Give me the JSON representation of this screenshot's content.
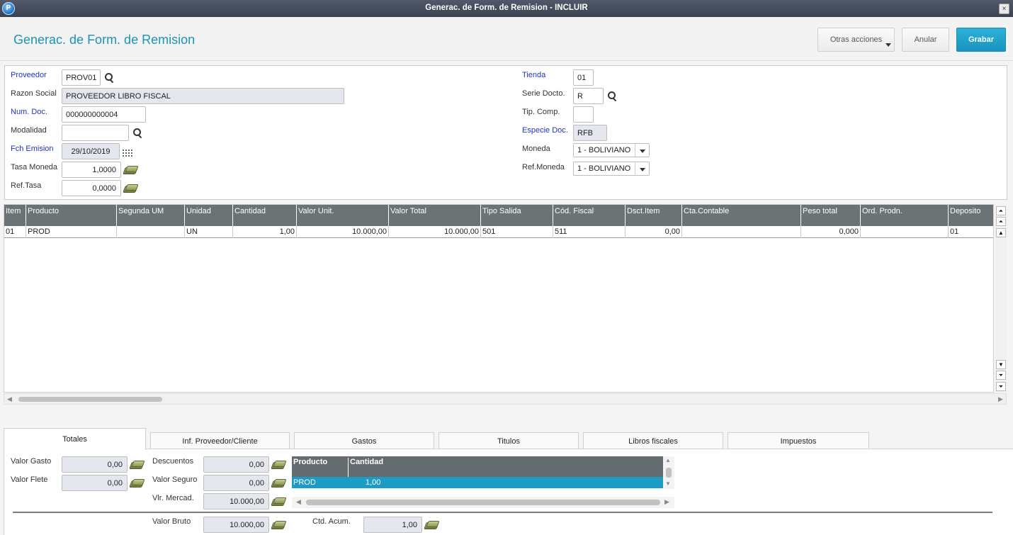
{
  "window": {
    "title": "Generac. de Form. de Remision - INCLUIR",
    "close_glyph": "×"
  },
  "header": {
    "page_title": "Generac. de Form. de Remision",
    "otras_label": "Otras acciones",
    "anular_label": "Anular",
    "grabar_label": "Grabar"
  },
  "form": {
    "proveedor": {
      "label": "Proveedor",
      "value": "PROV01"
    },
    "razon_social": {
      "label": "Razon Social",
      "value": "PROVEEDOR LIBRO FISCAL"
    },
    "num_doc": {
      "label": "Num. Doc.",
      "value": "000000000004"
    },
    "modalidad": {
      "label": "Modalidad",
      "value": ""
    },
    "fch_emision": {
      "label": "Fch Emision",
      "value": "29/10/2019"
    },
    "tasa_moneda": {
      "label": "Tasa Moneda",
      "value": "1,0000"
    },
    "ref_tasa": {
      "label": "Ref.Tasa",
      "value": "0,0000"
    },
    "tienda": {
      "label": "Tienda",
      "value": "01"
    },
    "serie_docto": {
      "label": "Serie Docto.",
      "value": "R"
    },
    "tip_comp": {
      "label": "Tip. Comp.",
      "value": ""
    },
    "especie_doc": {
      "label": "Especie Doc.",
      "value": "RFB"
    },
    "moneda": {
      "label": "Moneda",
      "value": "1 - BOLIVIANO"
    },
    "ref_moneda": {
      "label": "Ref.Moneda",
      "value": "1 - BOLIVIANO"
    }
  },
  "items_grid": {
    "columns": [
      "Item",
      "Producto",
      "Segunda UM",
      "Unidad",
      "Cantidad",
      "Valor Unit.",
      "Valor Total",
      "Tipo Salida",
      "Cód. Fiscal",
      "Dsct.Item",
      "Cta.Contable",
      "Peso total",
      "Ord. Prodn.",
      "Deposito"
    ],
    "rows": [
      [
        "01",
        "PROD",
        "",
        "UN",
        "1,00",
        "10.000,00",
        "10.000,00",
        "501",
        "511",
        "0,00",
        "",
        "0,000",
        "",
        "01"
      ]
    ]
  },
  "tabs": [
    "Totales",
    "Inf. Proveedor/Cliente",
    "Gastos",
    "Titulos",
    "Libros fiscales",
    "Impuestos"
  ],
  "totales": {
    "valor_gasto": {
      "label": "Valor Gasto",
      "value": "0,00"
    },
    "valor_flete": {
      "label": "Valor Flete",
      "value": "0,00"
    },
    "descuentos": {
      "label": "Descuentos",
      "value": "0,00"
    },
    "valor_seguro": {
      "label": "Valor Seguro",
      "value": "0,00"
    },
    "vlr_mercad": {
      "label": "Vlr. Mercad.",
      "value": "10.000,00"
    },
    "valor_bruto": {
      "label": "Valor Bruto",
      "value": "10.000,00"
    },
    "ctd_acum": {
      "label": "Ctd. Acum.",
      "value": "1,00"
    }
  },
  "mini_grid": {
    "columns": [
      "Producto",
      "Cantidad"
    ],
    "rows": [
      [
        "PROD",
        "1,00"
      ]
    ]
  },
  "colors": {
    "accent": "#1d93b8",
    "primary_button": "#1893bd",
    "grid_header": "#6c7377",
    "selected_row": "#1c9cc4",
    "required_label": "#1e32c8"
  }
}
